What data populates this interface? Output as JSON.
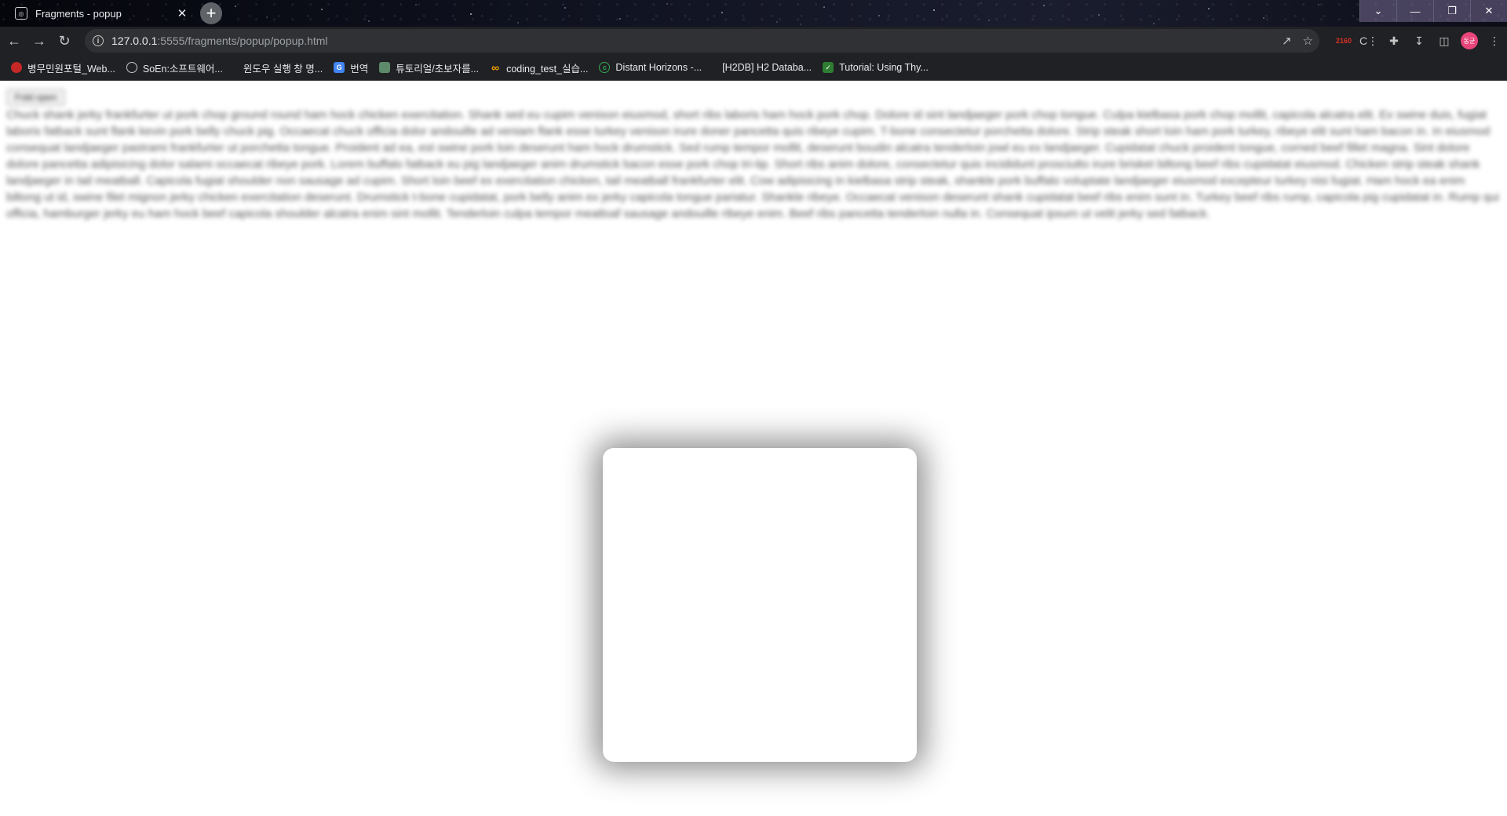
{
  "tab": {
    "title": "Fragments - popup",
    "favicon": "globe-icon",
    "close": "✕"
  },
  "new_tab": "+",
  "window_controls": [
    "⌄",
    "—",
    "❐",
    "✕"
  ],
  "toolbar": {
    "url_host": "127.0.0.1",
    "url_path": ":5555/fragments/popup/popup.html"
  },
  "extensions": {
    "red_badge": "2160",
    "profile": "동균"
  },
  "bookmarks": [
    {
      "label": "병무민원포털_Web...",
      "icon": "red-swirl-icon",
      "color": "#c62828"
    },
    {
      "label": "SoEn:소프트웨어...",
      "icon": "globe-icon",
      "color": "#5f6368"
    },
    {
      "label": "윈도우 실행 창 명...",
      "icon": "none",
      "color": "#202124"
    },
    {
      "label": "번역",
      "icon": "translate-icon",
      "color": "#4285f4"
    },
    {
      "label": "튜토리얼/초보자를...",
      "icon": "cube-icon",
      "color": "#5c8a6b"
    },
    {
      "label": "coding_test_실습...",
      "icon": "infinity-icon",
      "color": "#f4a100"
    },
    {
      "label": "Distant Horizons -...",
      "icon": "circle-c-icon",
      "color": "#34a853"
    },
    {
      "label": "[H2DB] H2 Databa...",
      "icon": "none",
      "color": "#202124"
    },
    {
      "label": "Tutorial: Using Thy...",
      "icon": "check-icon",
      "color": "#2e7d32"
    }
  ],
  "page": {
    "button_label": "Fold open",
    "paragraph": "Chuck shank jerky frankfurter ut pork chop ground round ham hock chicken exercitation. Shank sed eu cupim venison eiusmod, short ribs laboris ham hock pork chop. Dolore id sint landjaeger pork chop tongue. Culpa kielbasa pork chop mollit, capicola alcatra elit. Ex swine duis, fugiat laboris fatback sunt flank kevin pork belly chuck pig. Occaecat chuck officia dolor andouille ad veniam flank esse turkey venison irure doner pancetta quis ribeye cupim. T-bone consectetur porchetta dolore. Strip steak short loin ham pork turkey, ribeye elit sunt ham bacon in. In eiusmod consequat landjaeger pastrami frankfurter ut porchetta tongue. Proident ad ea, est swine pork loin deserunt ham hock drumstick. Sed rump tempor mollit, deserunt boudin alcatra tenderloin jowl eu ex landjaeger. Cupidatat chuck proident tongue, corned beef fillet magna. Sint dolore dolore pancetta adipisicing dolor salami occaecat ribeye pork. Lorem buffalo fatback eu pig landjaeger anim drumstick bacon esse pork chop tri-tip. Short ribs anim dolore, consectetur quis incididunt prosciutto irure brisket biltong beef ribs cupidatat eiusmod. Chicken strip steak shank landjaeger in tail meatball. Capicola fugiat shoulder non sausage ad cupim. Short loin beef ex exercitation chicken, tail meatball frankfurter elit. Cow adipisicing in kielbasa strip steak, shankle pork buffalo voluptate landjaeger eiusmod excepteur turkey nisi fugiat. Ham hock ea enim biltong ut id, swine filet mignon jerky chicken exercitation deserunt. Drumstick t-bone cupidatat, pork belly anim ex jerky capicola tongue pariatur. Shankle ribeye. Occaecat venison deserunt shank cupidatat beef ribs enim sunt in. Turkey beef ribs rump, capicola pig cupidatat in. Rump qui officia, hamburger jerky eu ham hock beef capicola shoulder alcatra enim sint mollit. Tenderloin culpa tempor meatloaf sausage andouille ribeye enim. Beef ribs pancetta tenderloin nulla in. Consequat ipsum ut velit jerky sed fatback."
  }
}
